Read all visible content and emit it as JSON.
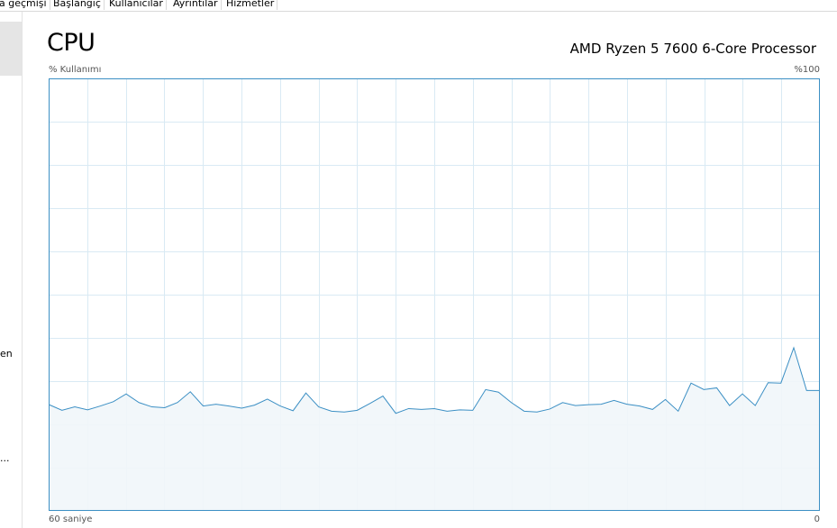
{
  "tabs": [
    {
      "label": "a geçmişi"
    },
    {
      "label": "Başlangıç"
    },
    {
      "label": "Kullanıcılar"
    },
    {
      "label": "Ayrıntılar"
    },
    {
      "label": "Hizmetler"
    }
  ],
  "sidebar": {
    "partial_items": [
      "en",
      "..."
    ]
  },
  "header": {
    "title": "CPU",
    "processor": "AMD Ryzen 5 7600 6-Core Processor"
  },
  "graph": {
    "y_label": "% Kullanımı",
    "y_max_label": "%100",
    "x_left_label": "60 saniye",
    "x_right_label": "0"
  },
  "colors": {
    "line": "#3b8fc4",
    "fill": "#f1f6fa",
    "grid": "#d9eaf4",
    "border": "#3b8fc4"
  },
  "chart_data": {
    "type": "area",
    "xlim": [
      60,
      0
    ],
    "ylim": [
      0,
      100
    ],
    "x": [
      60,
      59,
      58,
      57,
      56,
      55,
      54,
      53,
      52,
      51,
      50,
      49,
      48,
      47,
      46,
      45,
      44,
      43,
      42,
      41,
      40,
      39,
      38,
      37,
      36,
      35,
      34,
      33,
      32,
      31,
      30,
      29,
      28,
      27,
      26,
      25,
      24,
      23,
      22,
      21,
      20,
      19,
      18,
      17,
      16,
      15,
      14,
      13,
      12,
      11,
      10,
      9,
      8,
      7,
      6,
      5,
      4,
      3,
      2,
      1,
      0
    ],
    "series": [
      {
        "values": [
          24.5,
          23.2,
          24.0,
          23.3,
          24.2,
          25.2,
          27.0,
          25.0,
          24.0,
          23.8,
          25.0,
          27.5,
          24.2,
          24.6,
          24.2,
          23.7,
          24.4,
          25.8,
          24.2,
          23.1,
          27.2,
          24.0,
          23.0,
          22.8,
          23.2,
          24.8,
          26.5,
          22.5,
          23.6,
          23.4,
          23.6,
          23.0,
          23.3,
          23.2,
          28.0,
          27.4,
          25.0,
          23.0,
          22.8,
          23.5,
          25.0,
          24.3,
          24.5,
          24.6,
          25.5,
          24.6,
          24.2,
          23.4,
          25.7,
          23.0,
          29.5,
          28.0,
          28.4,
          24.3,
          27.0,
          24.3,
          29.6,
          29.5,
          37.7,
          27.8,
          27.8
        ]
      }
    ]
  }
}
